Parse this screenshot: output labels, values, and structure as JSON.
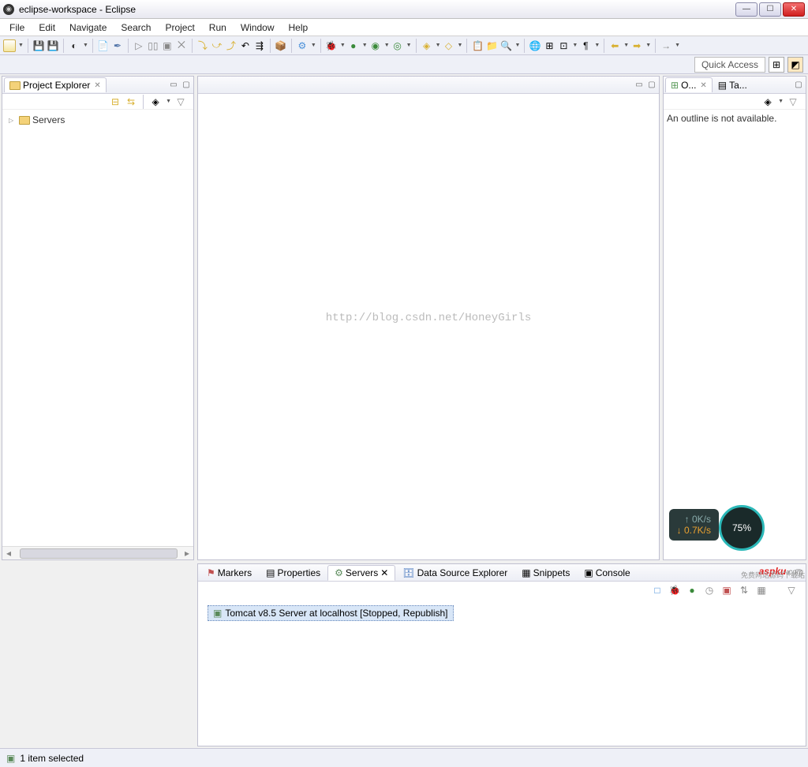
{
  "window": {
    "title": "eclipse-workspace - Eclipse"
  },
  "menu": [
    "File",
    "Edit",
    "Navigate",
    "Search",
    "Project",
    "Run",
    "Window",
    "Help"
  ],
  "quickaccess": "Quick Access",
  "project_explorer": {
    "title": "Project Explorer",
    "items": [
      "Servers"
    ]
  },
  "editor_watermark": "http://blog.csdn.net/HoneyGirls",
  "outline": {
    "tab1": "O...",
    "tab2": "Ta...",
    "message": "An outline is not available."
  },
  "bottom_tabs": {
    "markers": "Markers",
    "properties": "Properties",
    "servers": "Servers",
    "dse": "Data Source Explorer",
    "snippets": "Snippets",
    "console": "Console"
  },
  "server_item": "Tomcat v8.5 Server at localhost  [Stopped, Republish]",
  "status": "1 item selected",
  "widget": {
    "up": "0K/s",
    "down": "0.7K/s",
    "pct": "75%"
  },
  "branding": {
    "name": "aspku",
    "tld": ".com",
    "subtitle": "免费网站源码下载站"
  }
}
